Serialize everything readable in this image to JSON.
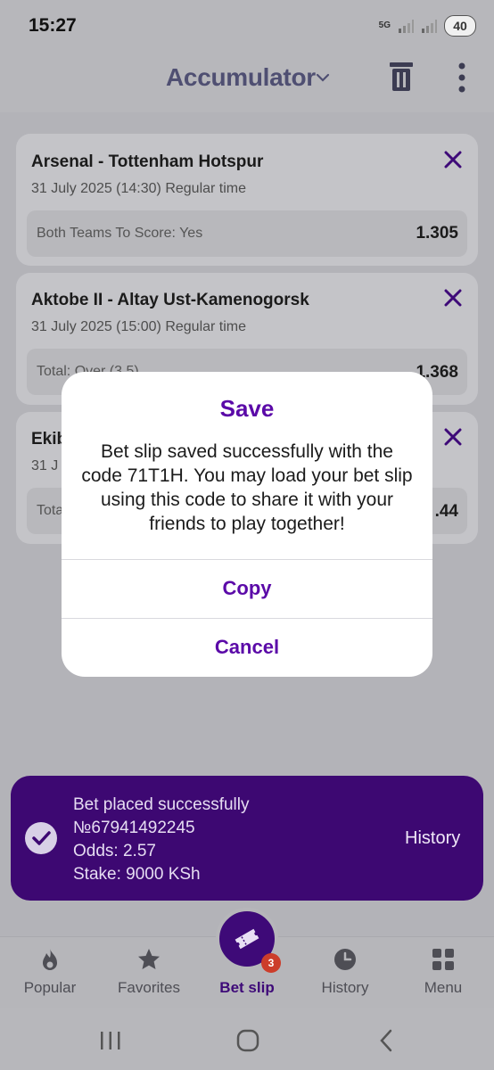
{
  "status_bar": {
    "time": "15:27",
    "network": "5G",
    "battery": "40"
  },
  "header": {
    "title": "Accumulator"
  },
  "bets": [
    {
      "match": "Arsenal - Tottenham Hotspur",
      "date": "31 July 2025 (14:30) Regular time",
      "market": "Both Teams To Score: Yes",
      "odds": "1.305"
    },
    {
      "match": "Aktobe II - Altay Ust-Kamenogorsk",
      "date": "31 July 2025 (15:00) Regular time",
      "market": "Total: Over (3.5)",
      "odds": "1.368"
    },
    {
      "match": "Ekib",
      "date": "31 J",
      "market": "Tota",
      "odds": ".44"
    }
  ],
  "dialog": {
    "title": "Save",
    "message": "Bet slip saved successfully with the code 71T1H. You may load your bet slip using this code to share it with your friends to play together!",
    "copy_label": "Copy",
    "cancel_label": "Cancel"
  },
  "toast": {
    "line1": "Bet placed successfully",
    "line2": "№67941492245",
    "line3": "Odds: 2.57",
    "line4": "Stake: 9000 KSh",
    "action_label": "History"
  },
  "bottom_nav": {
    "popular": "Popular",
    "favorites": "Favorites",
    "bet_slip": "Bet slip",
    "bet_slip_badge": "3",
    "history": "History",
    "menu": "Menu"
  },
  "colors": {
    "accent": "#5b0aa8",
    "toast_bg": "#3d0872",
    "badge": "#cc3d2b"
  }
}
